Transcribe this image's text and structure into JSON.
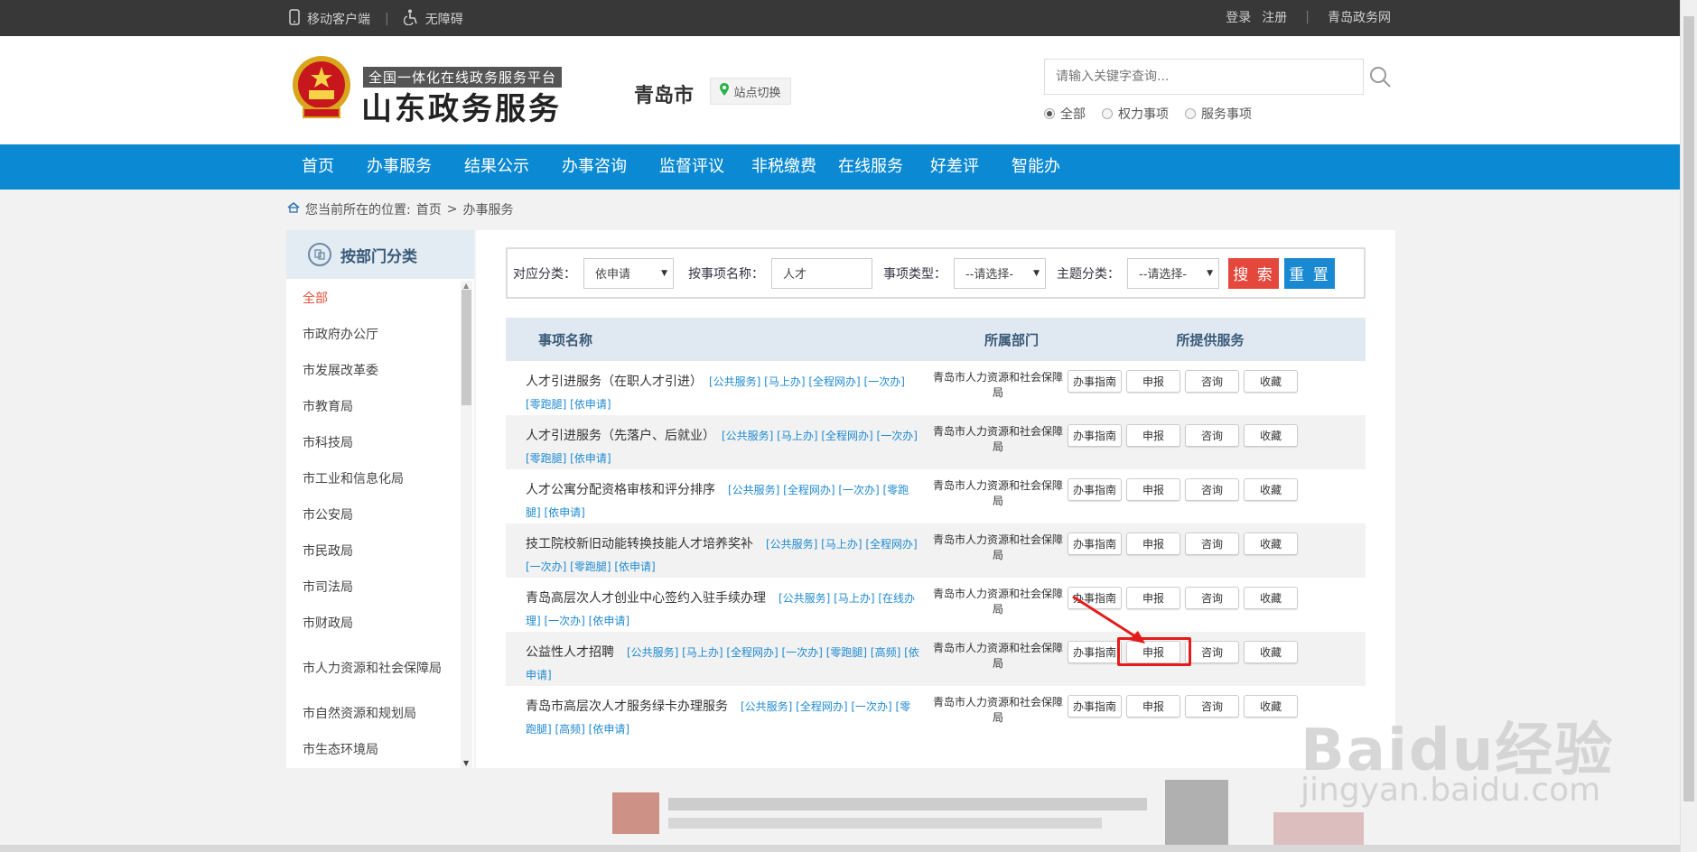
{
  "topbar": {
    "mobile_label": "移动客户端",
    "accessible_label": "无障碍",
    "login": "登录",
    "register": "注册",
    "site_link": "青岛政务网"
  },
  "header": {
    "logo_sub": "全国一体化在线政务服务平台",
    "logo_main": "山东政务服务",
    "city": "青岛市",
    "site_switch": "站点切换",
    "search_placeholder": "请输入关键字查询...",
    "radios": [
      {
        "label": "全部",
        "checked": true
      },
      {
        "label": "权力事项",
        "checked": false
      },
      {
        "label": "服务事项",
        "checked": false
      }
    ]
  },
  "nav": {
    "items": [
      "首页",
      "办事服务",
      "结果公示",
      "办事咨询",
      "监督评议",
      "非税缴费",
      "在线服务",
      "好差评",
      "智能办"
    ]
  },
  "breadcrumb": {
    "prefix": "您当前所在的位置:",
    "home": "首页",
    "sep": ">",
    "current": "办事服务"
  },
  "sidebar": {
    "title": "按部门分类",
    "items": [
      "全部",
      "市政府办公厅",
      "市发展改革委",
      "市教育局",
      "市科技局",
      "市工业和信息化局",
      "市公安局",
      "市民政局",
      "市司法局",
      "市财政局",
      "市人力资源和社会保障局",
      "市自然资源和规划局",
      "市生态环境局"
    ]
  },
  "filter": {
    "category_label": "对应分类：",
    "category_value": "依申请",
    "name_label": "按事项名称：",
    "name_value": "人才",
    "type_label": "事项类型：",
    "type_value": "--请选择-",
    "theme_label": "主题分类：",
    "theme_value": "--请选择-",
    "search_btn": "搜 索",
    "reset_btn": "重 置"
  },
  "table": {
    "headers": [
      "事项名称",
      "所属部门",
      "所提供服务"
    ],
    "actions": [
      "办事指南",
      "申报",
      "咨询",
      "收藏"
    ],
    "rows": [
      {
        "title": "人才引进服务（在职人才引进）",
        "tags": "[公共服务] [马上办] [全程网办] [一次办] [零跑腿] [依申请]",
        "dept": "青岛市人力资源和社会保障局"
      },
      {
        "title": "人才引进服务（先落户、后就业）",
        "tags": "[公共服务] [马上办] [全程网办] [一次办] [零跑腿] [依申请]",
        "dept": "青岛市人力资源和社会保障局"
      },
      {
        "title": "人才公寓分配资格审核和评分排序",
        "tags": "[公共服务] [全程网办] [一次办] [零跑腿] [依申请]",
        "dept": "青岛市人力资源和社会保障局"
      },
      {
        "title": "技工院校新旧动能转换技能人才培养奖补",
        "tags": "[公共服务] [马上办] [全程网办] [一次办] [零跑腿] [依申请]",
        "dept": "青岛市人力资源和社会保障局"
      },
      {
        "title": "青岛高层次人才创业中心签约入驻手续办理",
        "tags": "[公共服务] [马上办] [在线办理] [一次办] [依申请]",
        "dept": "青岛市人力资源和社会保障局"
      },
      {
        "title": "公益性人才招聘",
        "tags": "[公共服务] [马上办] [全程网办] [一次办] [零跑腿] [高频] [依申请]",
        "dept": "青岛市人力资源和社会保障局"
      },
      {
        "title": "青岛市高层次人才服务绿卡办理服务",
        "tags": "[公共服务] [全程网办] [一次办] [零跑腿] [高频] [依申请]",
        "dept": "青岛市人力资源和社会保障局"
      }
    ]
  },
  "watermark": {
    "logo": "Baidu经验",
    "url": "jingyan.baidu.com"
  },
  "colors": {
    "nav_bg": "#0b8ad3",
    "topbar_bg": "#383838",
    "search_btn": "#e4473b",
    "reset_btn": "#1989d1",
    "tag_blue": "#1f8ad2",
    "active_red": "#e4523b",
    "highlight_red": "#e51b1b"
  }
}
